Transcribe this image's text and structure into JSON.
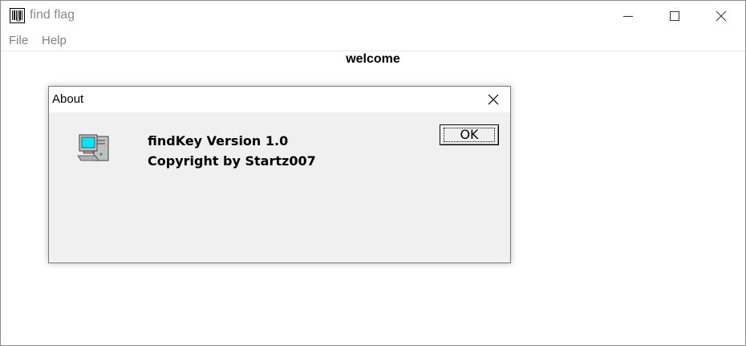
{
  "window": {
    "title": "find flag",
    "icon": "barcode-app-icon",
    "controls": [
      "minimize-icon",
      "maximize-icon",
      "close-icon"
    ]
  },
  "menu": {
    "items": [
      {
        "label": "File"
      },
      {
        "label": "Help"
      }
    ]
  },
  "main": {
    "welcome_text": "welcome"
  },
  "about_dialog": {
    "title": "About",
    "icon": "computer-icon",
    "version_text": "findKey Version 1.0",
    "copyright_text": "Copyright by Startz007",
    "ok_label": "OK"
  },
  "colors": {
    "title_text": "#8a8a8a",
    "dialog_bg": "#f0f0f0",
    "monitor_screen": "#00e5ff"
  }
}
